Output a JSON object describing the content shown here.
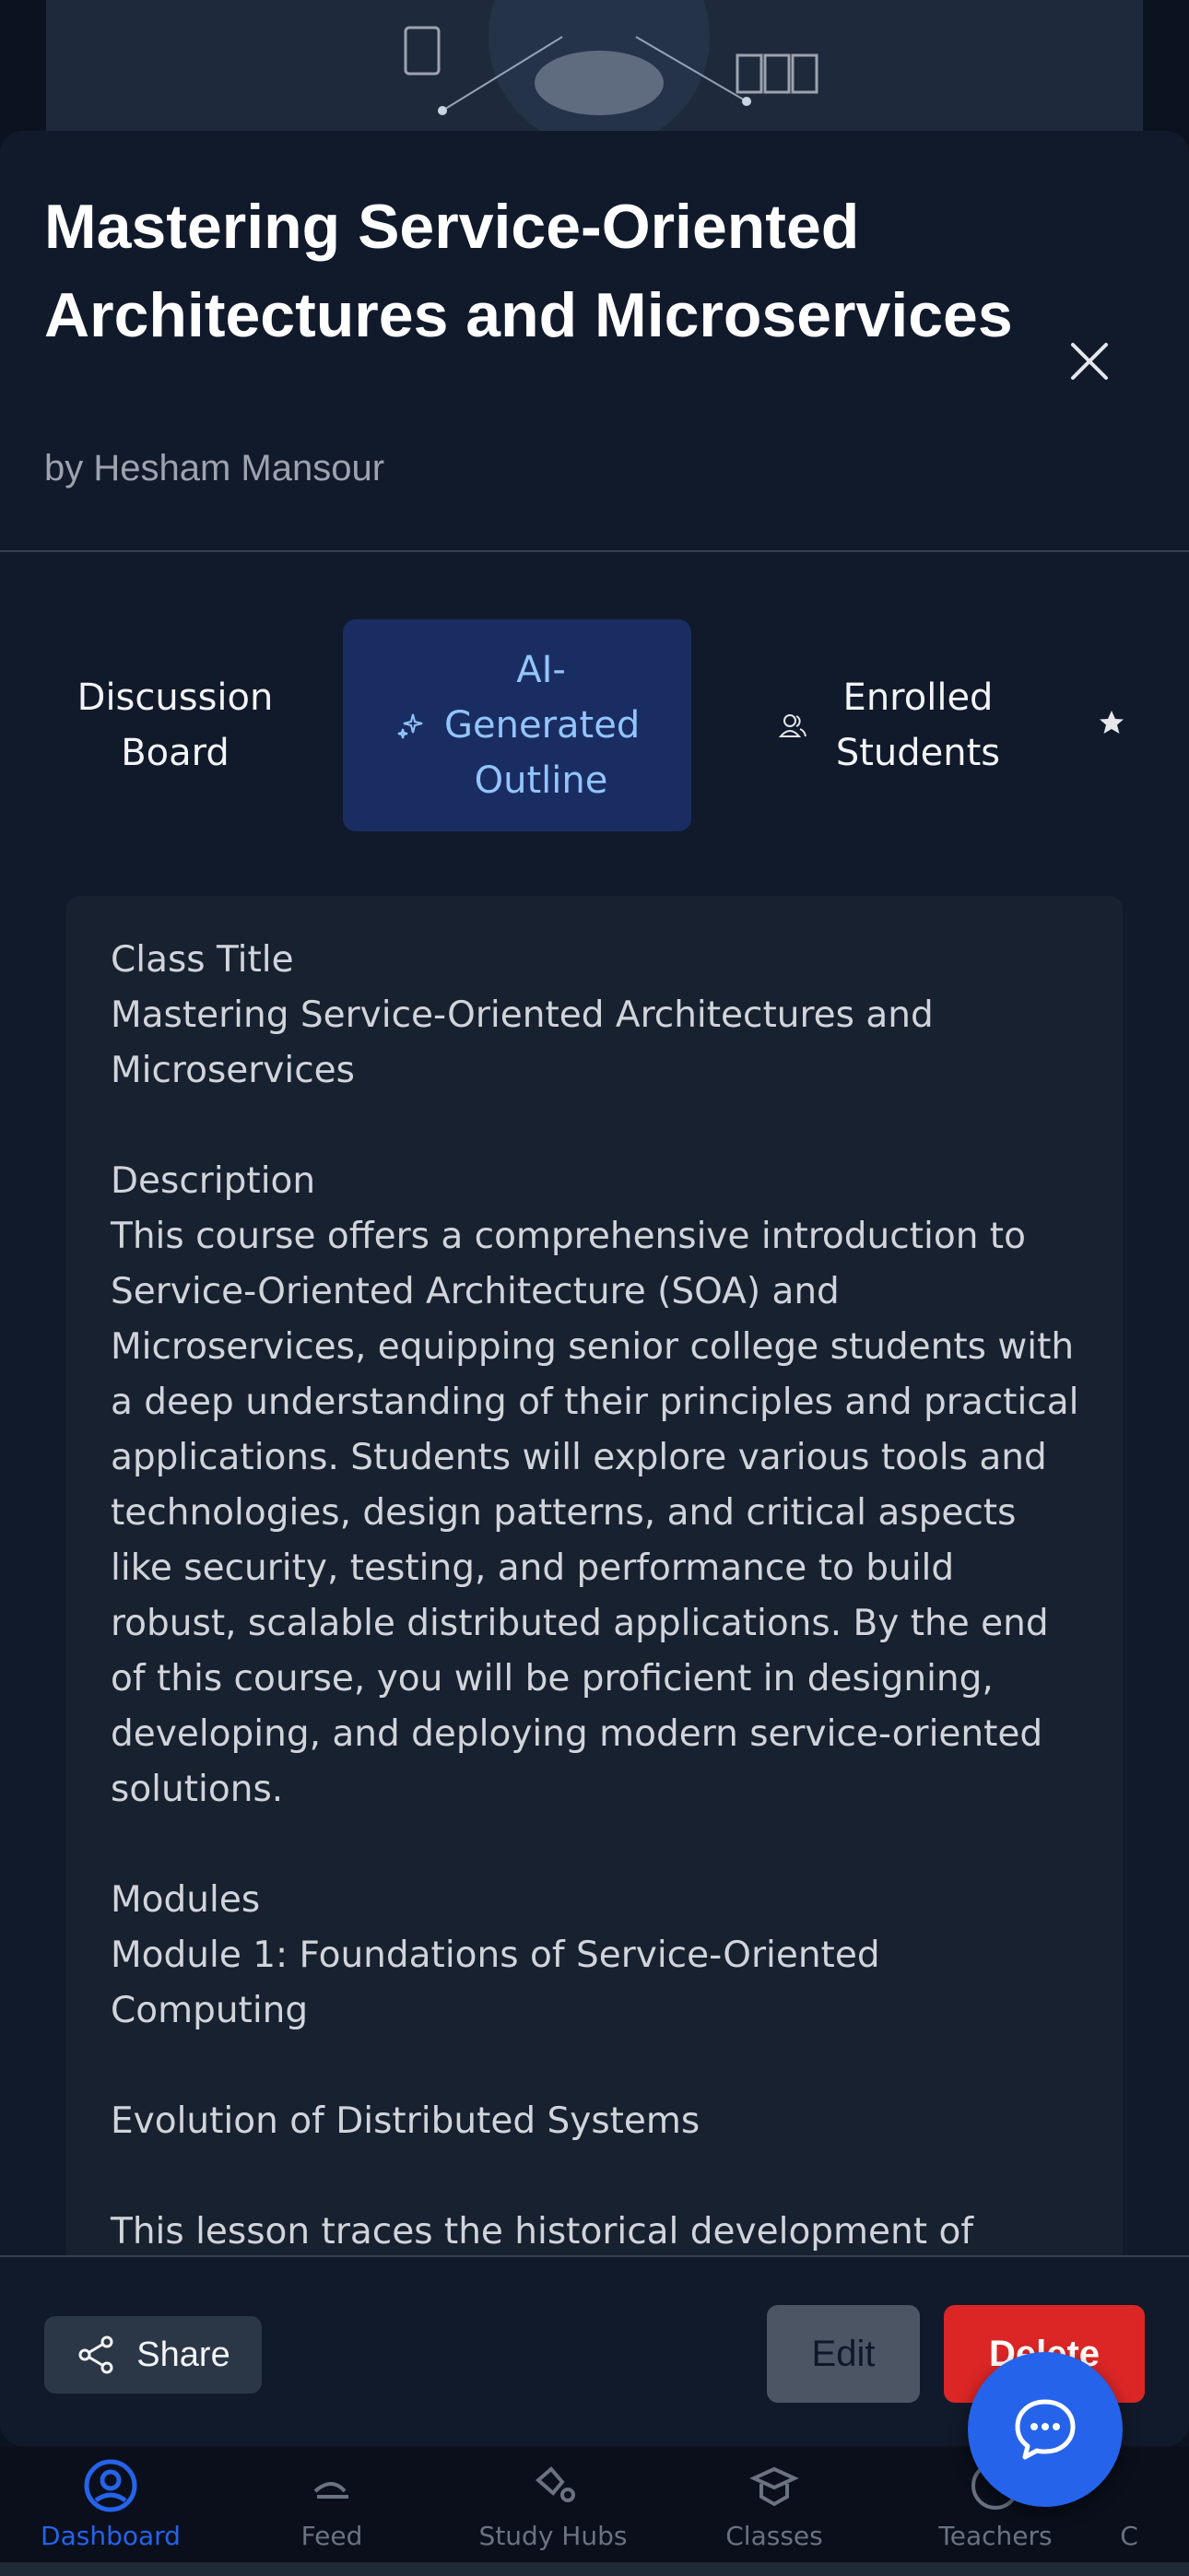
{
  "modal": {
    "title": "Mastering Service-Oriented Architectures and Microservices",
    "author": "by Hesham Mansour",
    "close_icon": "close-icon"
  },
  "tabs": [
    {
      "label": "Discussion Board",
      "icon": "",
      "active": false
    },
    {
      "label": "AI-Generated Outline",
      "icon": "sparkles-icon",
      "active": true
    },
    {
      "label": "Enrolled Students",
      "icon": "users-icon",
      "active": false
    },
    {
      "label": "",
      "icon": "star-icon",
      "active": false
    }
  ],
  "outline": {
    "class_title_heading": "Class Title",
    "class_title": "Mastering Service-Oriented Architectures and Microservices",
    "description_heading": "Description",
    "description": "This course offers a comprehensive introduction to Service-Oriented Architecture (SOA) and Microservices, equipping senior college students with a deep understanding of their principles and practical applications. Students will explore various tools and technologies, design patterns, and critical aspects like security, testing, and performance to build robust, scalable distributed applications. By the end of this course, you will be proficient in designing, developing, and deploying modern service-oriented solutions.",
    "modules_heading": "Modules",
    "module_1": "Module 1: Foundations of Service-Oriented Computing",
    "lesson_title": "Evolution of Distributed Systems",
    "lesson_text": "This lesson traces the historical development of distributed computing, from client-server to modern service-oriented paradigms."
  },
  "footer": {
    "share_label": "Share",
    "edit_label": "Edit",
    "delete_label": "Delete"
  },
  "bottom_nav": [
    {
      "label": "Dashboard",
      "icon": "user-circle-icon",
      "active": true
    },
    {
      "label": "Feed",
      "icon": "feed-icon",
      "active": false
    },
    {
      "label": "Study Hubs",
      "icon": "study-hubs-icon",
      "active": false
    },
    {
      "label": "Classes",
      "icon": "classes-icon",
      "active": false
    },
    {
      "label": "Teachers",
      "icon": "teachers-icon",
      "active": false
    },
    {
      "label": "C",
      "icon": "",
      "active": false
    }
  ],
  "colors": {
    "accent": "#2563eb",
    "danger": "#dc2626",
    "modal_bg": "#111a2b",
    "active_tab_bg": "#1a2d62"
  }
}
